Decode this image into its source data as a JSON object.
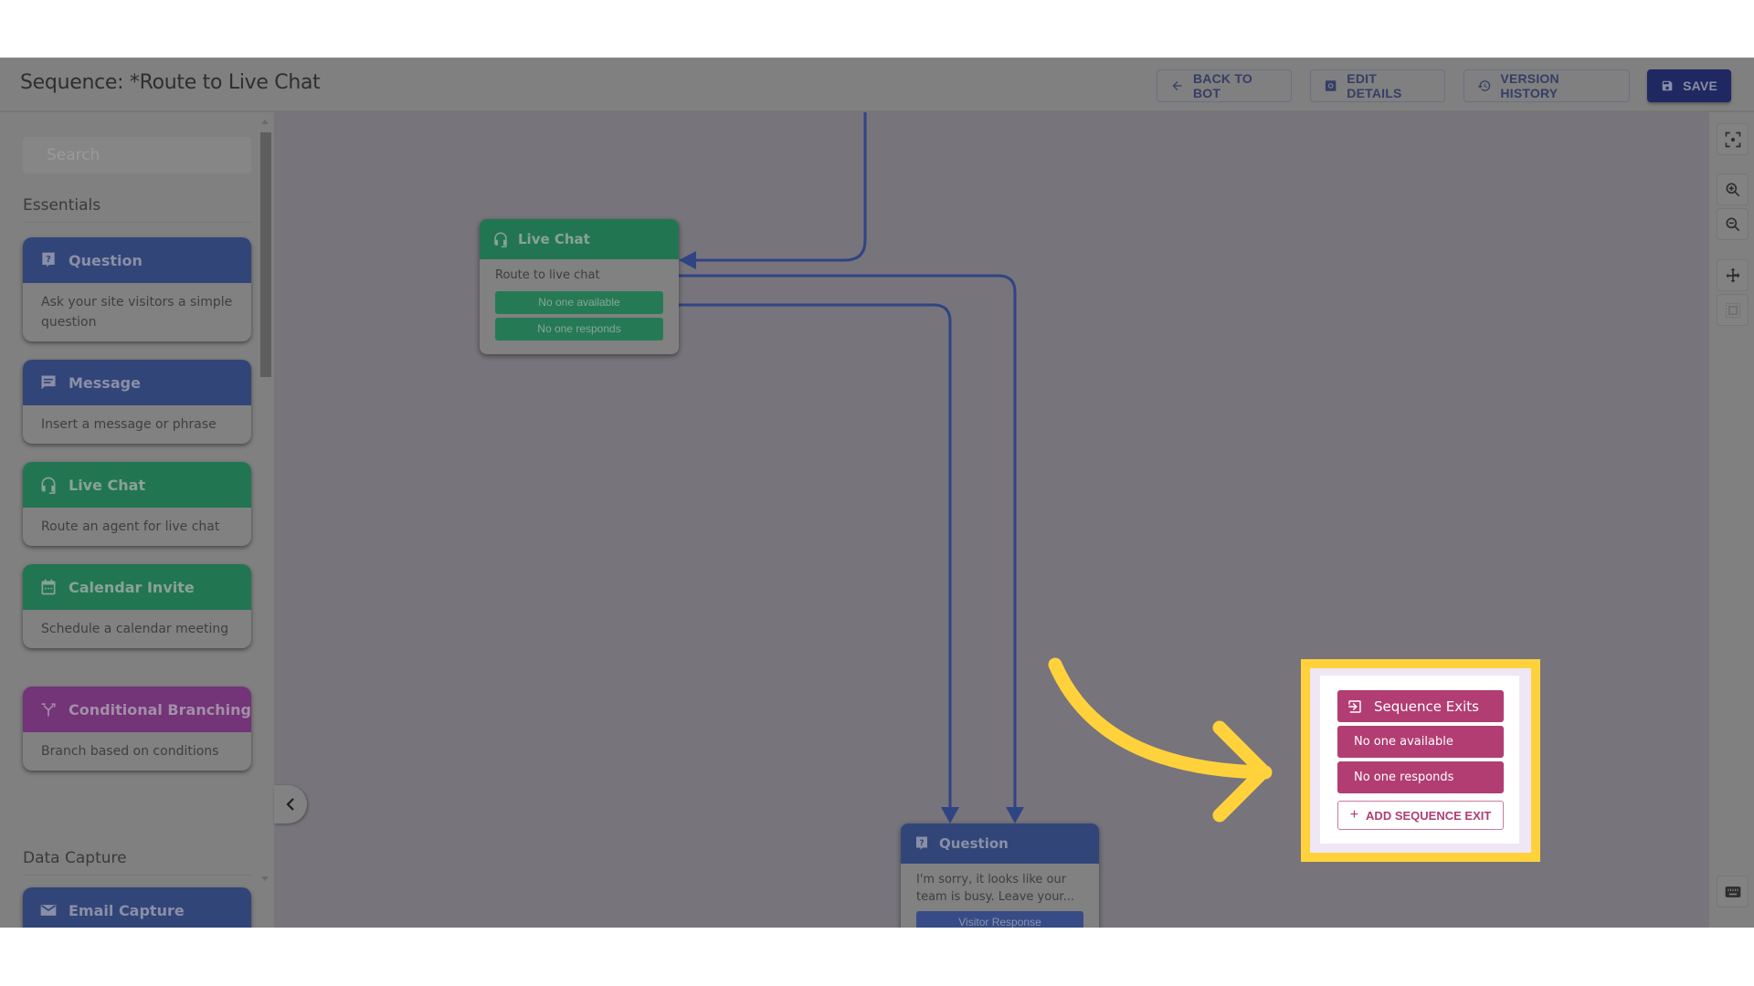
{
  "header": {
    "title": "Sequence: *Route to Live Chat",
    "buttons": {
      "back": "BACK TO BOT",
      "edit": "EDIT DETAILS",
      "history": "VERSION HISTORY",
      "save": "SAVE"
    }
  },
  "sidebar": {
    "search_placeholder": "Search",
    "sections": [
      {
        "title": "Essentials",
        "items": [
          {
            "label": "Question",
            "description": "Ask your site visitors a simple question",
            "icon": "question-icon",
            "color": "#324578"
          },
          {
            "label": "Message",
            "description": "Insert a message or phrase",
            "icon": "message-icon",
            "color": "#324578"
          },
          {
            "label": "Live Chat",
            "description": "Route an agent for live chat",
            "icon": "headset-icon",
            "color": "#227551"
          },
          {
            "label": "Calendar Invite",
            "description": "Schedule a calendar meeting",
            "icon": "calendar-icon",
            "color": "#227551"
          },
          {
            "label": "Conditional Branching",
            "description": "Branch based on conditions",
            "icon": "branch-icon",
            "color": "#733478"
          }
        ]
      },
      {
        "title": "Data Capture",
        "items": [
          {
            "label": "Email Capture",
            "description": "",
            "icon": "email-icon",
            "color": "#324578"
          }
        ]
      }
    ]
  },
  "canvas": {
    "nodes": {
      "live_chat": {
        "title": "Live Chat",
        "description": "Route to live chat",
        "ports": [
          "No one available",
          "No one responds"
        ]
      },
      "question": {
        "title": "Question",
        "description": "I'm sorry, it looks like our team is busy. Leave your...",
        "ports": [
          "Visitor Response"
        ]
      }
    }
  },
  "sequence_exits": {
    "title": "Sequence Exits",
    "exits": [
      "No one available",
      "No one responds"
    ],
    "add_label": "ADD SEQUENCE EXIT",
    "color": "#b13d72"
  },
  "controls": [
    "fit-view-icon",
    "zoom-in-icon",
    "zoom-out-icon",
    "pan-icon",
    "select-area-icon",
    "keyboard-icon"
  ],
  "annotation": {
    "color": "#ffd23c"
  }
}
